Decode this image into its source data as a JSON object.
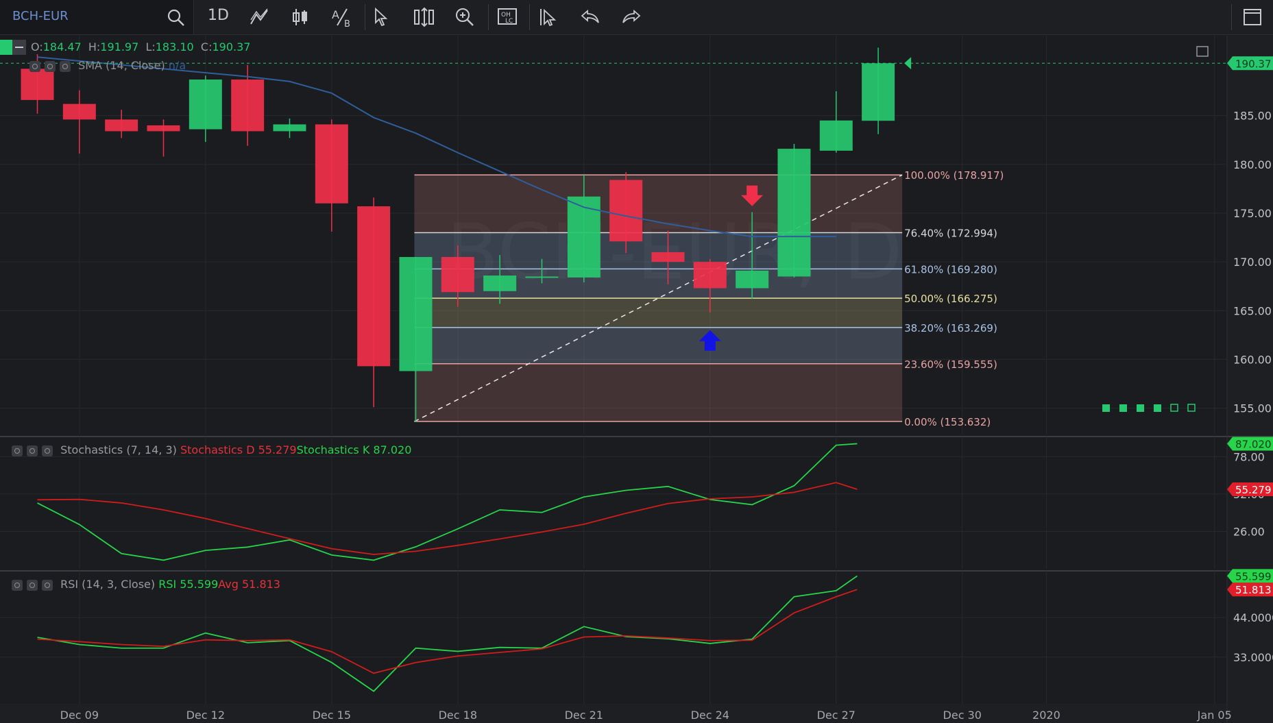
{
  "toolbar": {
    "symbol": "BCH-EUR",
    "interval": "1D",
    "icons": [
      "search-icon",
      "drawing-tools-icon",
      "candle-style-icon",
      "compare-icon",
      "cursor-icon",
      "scale-icon",
      "zoom-icon",
      "ohlc-icon",
      "select-icon",
      "undo-icon",
      "redo-icon",
      "layout-icon"
    ]
  },
  "legend": {
    "open_label": "O:",
    "open": "184.47",
    "high_label": "H:",
    "high": "191.97",
    "low_label": "L:",
    "low": "183.10",
    "close_label": "C:",
    "close": "190.37",
    "sma_label": "SMA (14, Close)",
    "sma_value": "n/a",
    "stoch_label": "Stochastics (7, 14, 3)",
    "stoch_d": "Stochastics D 55.279",
    "stoch_k": "Stochastics K 87.020",
    "rsi_label": "RSI (14, 3, Close)",
    "rsi_value": "RSI 55.599",
    "rsi_avg": "Avg 51.813"
  },
  "watermark": "BCH-EUR, D",
  "colors": {
    "up": "#26c96f",
    "down": "#f0304a",
    "sma": "#2f5e9a",
    "stoch_k": "#27d44a",
    "stoch_d": "#d11c1c",
    "background": "#1b1c1f"
  },
  "chart_data": [
    {
      "type": "candlestick",
      "title": "BCH-EUR",
      "x_ticks": [
        "Dec 09",
        "Dec 12",
        "Dec 15",
        "Dec 18",
        "Dec 21",
        "Dec 24",
        "Dec 27",
        "Dec 30",
        "2020",
        "Jan 05"
      ],
      "y_ticks": [
        "185.00",
        "180.00",
        "175.00",
        "170.00",
        "165.00",
        "160.00",
        "155.00"
      ],
      "ylim": [
        152.3,
        193.2
      ],
      "last_price_label": "190.37",
      "candles": [
        {
          "date": "Dec 08",
          "open": 189.8,
          "high": 191.3,
          "low": 185.2,
          "close": 186.6
        },
        {
          "date": "Dec 09",
          "open": 186.2,
          "high": 187.6,
          "low": 181.1,
          "close": 184.6
        },
        {
          "date": "Dec 10",
          "open": 184.6,
          "high": 185.6,
          "low": 182.7,
          "close": 183.4
        },
        {
          "date": "Dec 11",
          "open": 184.0,
          "high": 184.6,
          "low": 180.8,
          "close": 183.4
        },
        {
          "date": "Dec 12",
          "open": 183.6,
          "high": 189.1,
          "low": 182.3,
          "close": 188.7
        },
        {
          "date": "Dec 13",
          "open": 188.7,
          "high": 190.2,
          "low": 181.9,
          "close": 183.4
        },
        {
          "date": "Dec 14",
          "open": 183.4,
          "high": 184.7,
          "low": 182.7,
          "close": 184.1
        },
        {
          "date": "Dec 15",
          "open": 184.1,
          "high": 184.6,
          "low": 173.1,
          "close": 176.0
        },
        {
          "date": "Dec 16",
          "open": 175.7,
          "high": 176.6,
          "low": 155.1,
          "close": 159.3
        },
        {
          "date": "Dec 17",
          "open": 158.8,
          "high": 170.5,
          "low": 153.6,
          "close": 170.5
        },
        {
          "date": "Dec 18",
          "open": 170.5,
          "high": 171.7,
          "low": 165.4,
          "close": 166.9
        },
        {
          "date": "Dec 19",
          "open": 167.0,
          "high": 170.7,
          "low": 165.7,
          "close": 168.6
        },
        {
          "date": "Dec 20",
          "open": 168.5,
          "high": 170.3,
          "low": 167.8,
          "close": 168.5
        },
        {
          "date": "Dec 21",
          "open": 168.4,
          "high": 179.0,
          "low": 167.9,
          "close": 176.7
        },
        {
          "date": "Dec 22",
          "open": 178.4,
          "high": 179.2,
          "low": 170.9,
          "close": 172.1
        },
        {
          "date": "Dec 23",
          "open": 171.0,
          "high": 173.2,
          "low": 167.7,
          "close": 170.0
        },
        {
          "date": "Dec 24",
          "open": 170.0,
          "high": 170.3,
          "low": 164.8,
          "close": 167.3
        },
        {
          "date": "Dec 25",
          "open": 167.3,
          "high": 175.1,
          "low": 166.2,
          "close": 169.1
        },
        {
          "date": "Dec 26",
          "open": 168.5,
          "high": 182.1,
          "low": 168.4,
          "close": 181.6
        },
        {
          "date": "Dec 27",
          "open": 181.4,
          "high": 187.5,
          "low": 181.2,
          "close": 184.5
        },
        {
          "date": "Dec 28",
          "open": 184.47,
          "high": 191.97,
          "low": 183.1,
          "close": 190.37
        }
      ],
      "sma": [
        {
          "date": "Dec 08",
          "value": 191.0
        },
        {
          "date": "Dec 09",
          "value": 190.6
        },
        {
          "date": "Dec 10",
          "value": 190.2
        },
        {
          "date": "Dec 11",
          "value": 189.8
        },
        {
          "date": "Dec 12",
          "value": 189.4
        },
        {
          "date": "Dec 13",
          "value": 189.0
        },
        {
          "date": "Dec 14",
          "value": 188.5
        },
        {
          "date": "Dec 15",
          "value": 187.3
        },
        {
          "date": "Dec 16",
          "value": 184.8
        },
        {
          "date": "Dec 17",
          "value": 183.2
        },
        {
          "date": "Dec 18",
          "value": 181.2
        },
        {
          "date": "Dec 19",
          "value": 179.3
        },
        {
          "date": "Dec 20",
          "value": 177.4
        },
        {
          "date": "Dec 21",
          "value": 175.6
        },
        {
          "date": "Dec 22",
          "value": 174.7
        },
        {
          "date": "Dec 23",
          "value": 173.9
        },
        {
          "date": "Dec 24",
          "value": 173.2
        },
        {
          "date": "Dec 25",
          "value": 172.6
        },
        {
          "date": "Dec 26",
          "value": 172.6
        },
        {
          "date": "Dec 27",
          "value": 172.6
        }
      ],
      "fibonacci": [
        {
          "label": "100.00% (178.917)",
          "price": 178.917,
          "color": "#e8a3a3"
        },
        {
          "label": "76.40% (172.994)",
          "price": 172.994,
          "color": "#d8d8d8"
        },
        {
          "label": "61.80% (169.280)",
          "price": 169.28,
          "color": "#a9c3e6"
        },
        {
          "label": "50.00% (166.275)",
          "price": 166.275,
          "color": "#e8e0a0"
        },
        {
          "label": "38.20% (163.269)",
          "price": 163.269,
          "color": "#a9c3e6"
        },
        {
          "label": "23.60% (159.555)",
          "price": 159.555,
          "color": "#e8a3a3"
        },
        {
          "label": "0.00% (153.632)",
          "price": 153.632,
          "color": "#e8a3a3"
        }
      ],
      "fib_range": {
        "start": "Dec 17",
        "end": "Dec 28"
      },
      "markers": [
        {
          "type": "sell-arrow",
          "date": "Dec 25",
          "price": 175.3,
          "color": "#f0304a"
        },
        {
          "type": "buy-arrow",
          "date": "Dec 24",
          "price": 163.0,
          "color": "#1313e6"
        }
      ]
    },
    {
      "type": "line",
      "title": "Stochastics (7, 14, 3)",
      "y_ticks": [
        "78.00",
        "52.00",
        "26.00"
      ],
      "ylim": [
        0,
        92
      ],
      "series": [
        {
          "name": "Stochastics K",
          "color": "#27d44a",
          "last_label": "87.020",
          "points": [
            {
              "date": "Dec 08",
              "value": 45.8
            },
            {
              "date": "Dec 09",
              "value": 30.8
            },
            {
              "date": "Dec 10",
              "value": 10.6
            },
            {
              "date": "Dec 11",
              "value": 6.0
            },
            {
              "date": "Dec 12",
              "value": 12.8
            },
            {
              "date": "Dec 13",
              "value": 15.1
            },
            {
              "date": "Dec 14",
              "value": 20.1
            },
            {
              "date": "Dec 15",
              "value": 9.6
            },
            {
              "date": "Dec 16",
              "value": 6.0
            },
            {
              "date": "Dec 17",
              "value": 15.3
            },
            {
              "date": "Dec 18",
              "value": 27.8
            },
            {
              "date": "Dec 19",
              "value": 41.0
            },
            {
              "date": "Dec 20",
              "value": 39.2
            },
            {
              "date": "Dec 21",
              "value": 50.0
            },
            {
              "date": "Dec 22",
              "value": 54.6
            },
            {
              "date": "Dec 23",
              "value": 57.3
            },
            {
              "date": "Dec 24",
              "value": 48.2
            },
            {
              "date": "Dec 25",
              "value": 44.6
            },
            {
              "date": "Dec 26",
              "value": 57.8
            },
            {
              "date": "Dec 27",
              "value": 86.0
            },
            {
              "date": "Dec 27.5",
              "value": 87.02
            }
          ]
        },
        {
          "name": "Stochastics D",
          "color": "#d11c1c",
          "last_label": "55.279",
          "points": [
            {
              "date": "Dec 08",
              "value": 48.0
            },
            {
              "date": "Dec 09",
              "value": 48.3
            },
            {
              "date": "Dec 10",
              "value": 45.8
            },
            {
              "date": "Dec 11",
              "value": 41.0
            },
            {
              "date": "Dec 12",
              "value": 35.0
            },
            {
              "date": "Dec 13",
              "value": 28.0
            },
            {
              "date": "Dec 14",
              "value": 21.0
            },
            {
              "date": "Dec 15",
              "value": 14.0
            },
            {
              "date": "Dec 16",
              "value": 10.0
            },
            {
              "date": "Dec 17",
              "value": 12.2
            },
            {
              "date": "Dec 18",
              "value": 16.3
            },
            {
              "date": "Dec 19",
              "value": 20.8
            },
            {
              "date": "Dec 20",
              "value": 25.6
            },
            {
              "date": "Dec 21",
              "value": 31.0
            },
            {
              "date": "Dec 22",
              "value": 38.6
            },
            {
              "date": "Dec 23",
              "value": 45.4
            },
            {
              "date": "Dec 24",
              "value": 48.7
            },
            {
              "date": "Dec 25",
              "value": 50.0
            },
            {
              "date": "Dec 26",
              "value": 53.2
            },
            {
              "date": "Dec 27",
              "value": 60.0
            },
            {
              "date": "Dec 27.5",
              "value": 55.279
            }
          ]
        }
      ]
    },
    {
      "type": "line",
      "title": "RSI (14, 3, Close)",
      "y_ticks": [
        "44.0000",
        "33.0000"
      ],
      "ylim": [
        20,
        57
      ],
      "series": [
        {
          "name": "RSI",
          "color": "#27d44a",
          "last_label": "55.599",
          "points": [
            {
              "date": "Dec 08",
              "value": 38.5
            },
            {
              "date": "Dec 09",
              "value": 36.5
            },
            {
              "date": "Dec 10",
              "value": 35.5
            },
            {
              "date": "Dec 11",
              "value": 35.5
            },
            {
              "date": "Dec 12",
              "value": 39.7
            },
            {
              "date": "Dec 13",
              "value": 37.0
            },
            {
              "date": "Dec 14",
              "value": 37.6
            },
            {
              "date": "Dec 15",
              "value": 31.5
            },
            {
              "date": "Dec 16",
              "value": 23.5
            },
            {
              "date": "Dec 17",
              "value": 35.5
            },
            {
              "date": "Dec 18",
              "value": 34.6
            },
            {
              "date": "Dec 19",
              "value": 35.7
            },
            {
              "date": "Dec 20",
              "value": 35.5
            },
            {
              "date": "Dec 21",
              "value": 41.5
            },
            {
              "date": "Dec 22",
              "value": 38.7
            },
            {
              "date": "Dec 23",
              "value": 38.1
            },
            {
              "date": "Dec 24",
              "value": 36.8
            },
            {
              "date": "Dec 25",
              "value": 38.0
            },
            {
              "date": "Dec 26",
              "value": 49.8
            },
            {
              "date": "Dec 27",
              "value": 51.5
            },
            {
              "date": "Dec 27.5",
              "value": 55.599
            }
          ]
        },
        {
          "name": "Avg",
          "color": "#d11c1c",
          "last_label": "51.813",
          "points": [
            {
              "date": "Dec 08",
              "value": 38.0
            },
            {
              "date": "Dec 09",
              "value": 37.3
            },
            {
              "date": "Dec 10",
              "value": 36.5
            },
            {
              "date": "Dec 11",
              "value": 36.0
            },
            {
              "date": "Dec 12",
              "value": 37.8
            },
            {
              "date": "Dec 13",
              "value": 37.6
            },
            {
              "date": "Dec 14",
              "value": 37.8
            },
            {
              "date": "Dec 15",
              "value": 34.5
            },
            {
              "date": "Dec 16",
              "value": 28.5
            },
            {
              "date": "Dec 17",
              "value": 31.5
            },
            {
              "date": "Dec 18",
              "value": 33.3
            },
            {
              "date": "Dec 19",
              "value": 34.3
            },
            {
              "date": "Dec 20",
              "value": 35.3
            },
            {
              "date": "Dec 21",
              "value": 38.6
            },
            {
              "date": "Dec 22",
              "value": 38.9
            },
            {
              "date": "Dec 23",
              "value": 38.3
            },
            {
              "date": "Dec 24",
              "value": 37.6
            },
            {
              "date": "Dec 25",
              "value": 37.7
            },
            {
              "date": "Dec 26",
              "value": 45.3
            },
            {
              "date": "Dec 27",
              "value": 49.8
            },
            {
              "date": "Dec 27.5",
              "value": 51.813
            }
          ]
        }
      ]
    }
  ]
}
